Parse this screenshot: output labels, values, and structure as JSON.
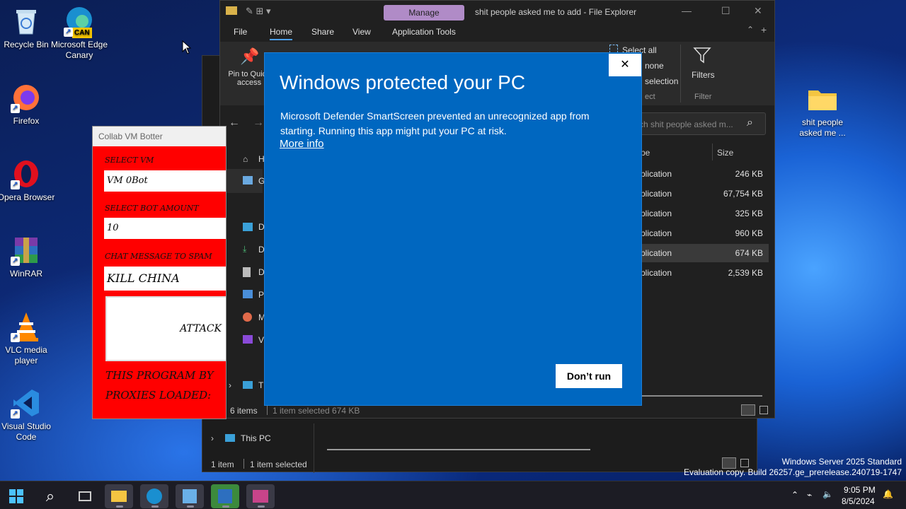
{
  "desktop": {
    "icons": [
      {
        "label": "Recycle Bin",
        "icon": "recycle-bin"
      },
      {
        "label": "Microsoft Edge Canary",
        "icon": "edge-canary",
        "badge": "CAN"
      },
      {
        "label": "Firefox",
        "icon": "firefox"
      },
      {
        "label": "Opera Browser",
        "icon": "opera"
      },
      {
        "label": "WinRAR",
        "icon": "winrar"
      },
      {
        "label": "VLC media player",
        "icon": "vlc"
      },
      {
        "label": "Visual Studio Code",
        "icon": "vscode"
      },
      {
        "label": "shit people asked me ...",
        "icon": "folder"
      }
    ]
  },
  "explorer": {
    "manage_tab": "Manage",
    "title": "shit people asked me to add - File Explorer",
    "menu": [
      "File",
      "Home",
      "Share",
      "View",
      "Application Tools"
    ],
    "ribbon": {
      "pin_label": "Pin to Quick access",
      "select_all": "Select all",
      "select_none": "none",
      "invert_selection": "selection",
      "select_group": "ect",
      "filters_label": "Filters",
      "filter_group": "Filter"
    },
    "search_placeholder": "ch shit people asked m...",
    "columns": {
      "type": "pe",
      "size": "Size"
    },
    "nav_items": [
      "H",
      "G",
      "D",
      "D",
      "D",
      "Pi",
      "M",
      "Vi",
      "T"
    ],
    "files": [
      {
        "type": "plication",
        "size": "246 KB",
        "selected": false
      },
      {
        "type": "plication",
        "size": "67,754 KB",
        "selected": false
      },
      {
        "type": "plication",
        "size": "325 KB",
        "selected": false
      },
      {
        "type": "plication",
        "size": "960 KB",
        "selected": false
      },
      {
        "type": "plication",
        "size": "674 KB",
        "selected": true
      },
      {
        "type": "plication",
        "size": "2,539 KB",
        "selected": false
      }
    ],
    "status": {
      "count": "6 items",
      "selected": "1 item selected  674 KB"
    }
  },
  "explorer_back": {
    "nav_item": "This PC",
    "status": {
      "count": "1 item",
      "selected": "1 item selected"
    }
  },
  "bot": {
    "title": "Collab VM Botter",
    "select_vm_label": "SELECT VM",
    "vm_value": "VM 0Bot",
    "bot_amount_label": "SELECT BOT AMOUNT",
    "bot_amount_value": "10",
    "chat_label": "CHAT MESSAGE TO SPAM",
    "chat_value": "KILL CHINA",
    "attack_label": "ATTACK",
    "footer_line1": "THIS PROGRAM BY",
    "footer_line2": "PROXIES LOADED:"
  },
  "dialog": {
    "title": "Windows protected your PC",
    "message": "Microsoft Defender SmartScreen prevented an unrecognized app from starting. Running this app might put your PC at risk.",
    "more_info": "More info",
    "dont_run": "Don’t run",
    "accent": "#0067c0"
  },
  "watermark": {
    "line1": "Windows Server 2025 Standard",
    "line2": "Evaluation copy. Build 26257.ge_prerelease.240719-1747"
  },
  "taskbar": {
    "apps": [
      "start",
      "search",
      "task-view",
      "file-explorer",
      "edge-canary",
      "app",
      "winrar",
      "app2"
    ],
    "time": "9:05 PM",
    "date": "8/5/2024"
  }
}
